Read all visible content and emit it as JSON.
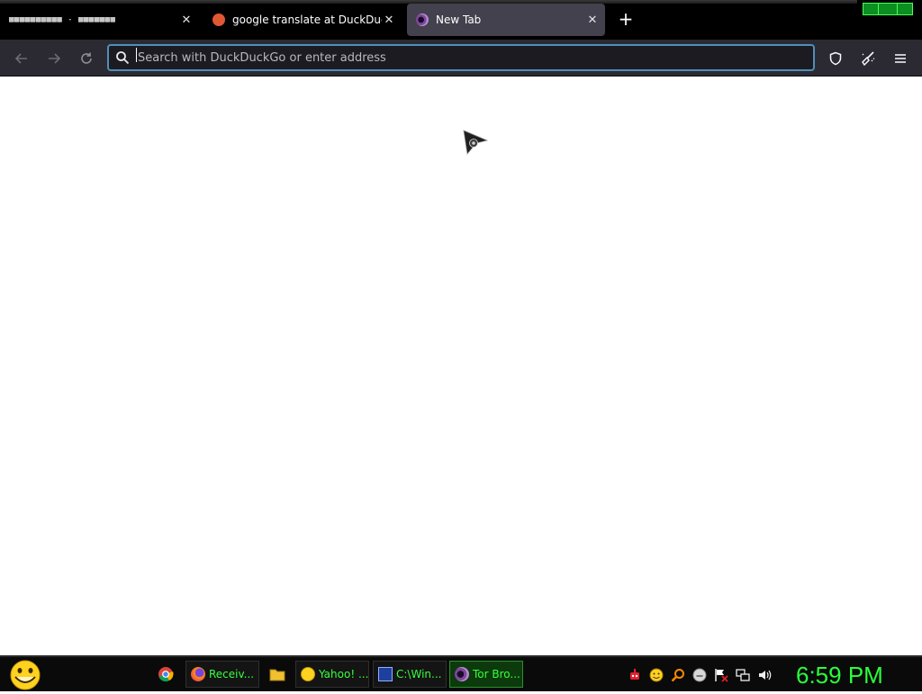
{
  "tabs": [
    {
      "title": "▦▦▦▦▦▦▦▦▦▦ - ▦▦▦▦▦▦▦",
      "favicon": "glyph-grid-icon",
      "close": "✕",
      "active": false
    },
    {
      "title": "google translate at DuckDuckGo",
      "favicon": "duckduckgo-icon",
      "close": "✕",
      "active": false
    },
    {
      "title": "New Tab",
      "favicon": "tor-onion-icon",
      "close": "✕",
      "active": true
    }
  ],
  "new_tab": {
    "label": "+"
  },
  "toolbar": {
    "back": "back-arrow-icon",
    "forward": "forward-arrow-icon",
    "reload": "reload-icon",
    "url_placeholder": "Search with DuckDuckGo or enter address",
    "shield": "shield-icon",
    "new_identity": "broom-icon",
    "menu": "hamburger-menu-icon"
  },
  "taskbar": {
    "tasks": [
      {
        "label": "Receiv...",
        "icon": "firefox-icon"
      },
      {
        "label": "Yahoo! ...",
        "icon": "yahoo-messenger-icon"
      },
      {
        "label": "C:\\Win...",
        "icon": "window-icon"
      },
      {
        "label": "Tor Bro...",
        "icon": "tor-onion-icon"
      }
    ],
    "clock": "6:59 PM"
  },
  "colors": {
    "tab_active_bg": "#42414d",
    "toolbar_bg": "#2b2a33",
    "urlbar_bg": "#1c1b22",
    "urlbar_focus": "#4f8fb8",
    "taskbar_text": "#37ff3e",
    "clock_text": "#29ff3a"
  }
}
